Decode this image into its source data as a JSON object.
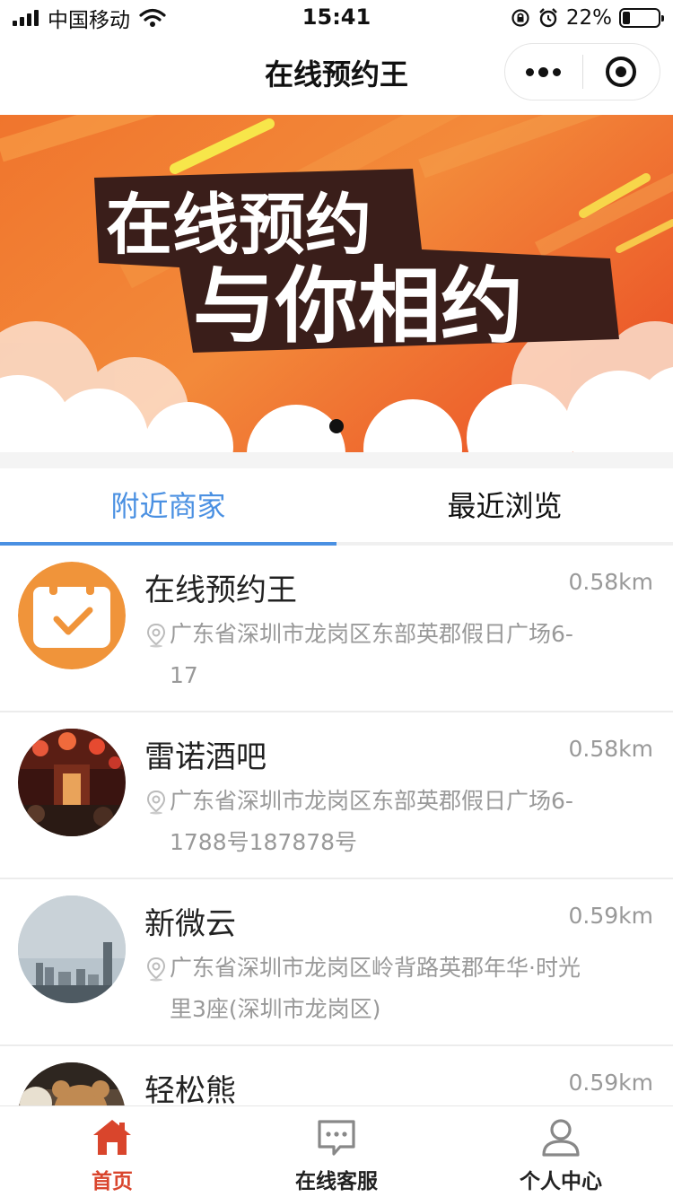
{
  "status_bar": {
    "carrier": "中国移动",
    "time": "15:41",
    "battery_percent": "22%"
  },
  "nav": {
    "title": "在线预约王"
  },
  "banner": {
    "line1": "在线预约",
    "line2": "与你相约",
    "indicator_count": 1,
    "active_index": 0
  },
  "tabs": [
    {
      "label": "附近商家",
      "active": true
    },
    {
      "label": "最近浏览",
      "active": false
    }
  ],
  "merchants": [
    {
      "name": "在线预约王",
      "distance": "0.58km",
      "address_line1": "广东省深圳市龙岗区东部英郡假日广场6-",
      "address_line2": "17",
      "avatar": "calendar-check-icon"
    },
    {
      "name": "雷诺酒吧",
      "distance": "0.58km",
      "address_line1": "广东省深圳市龙岗区东部英郡假日广场6-",
      "address_line2": "1788号187878号",
      "avatar": "bar-photo"
    },
    {
      "name": "新微云",
      "distance": "0.59km",
      "address_line1": "广东省深圳市龙岗区岭背路英郡年华·时光",
      "address_line2": "里3座(深圳市龙岗区)",
      "avatar": "skyline-photo"
    },
    {
      "name": "轻松熊",
      "distance": "0.59km",
      "address_line1": "",
      "address_line2": "",
      "avatar": "bear-photo"
    }
  ],
  "tabbar": [
    {
      "label": "首页",
      "icon": "home-icon",
      "active": true
    },
    {
      "label": "在线客服",
      "icon": "chat-icon",
      "active": false
    },
    {
      "label": "个人中心",
      "icon": "user-icon",
      "active": false
    }
  ],
  "colors": {
    "accent_blue": "#4a90e2",
    "active_red": "#d9452c",
    "banner_orange": "#f0772f",
    "avatar_orange": "#f0943a"
  }
}
